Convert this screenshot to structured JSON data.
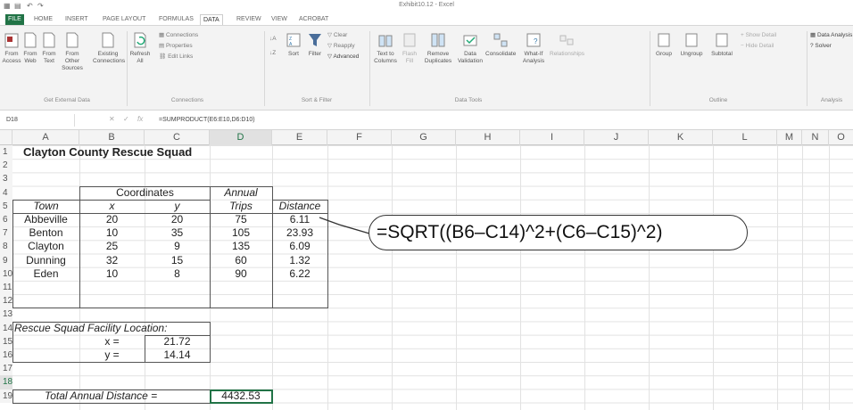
{
  "window": {
    "title": "Exhibit10.12 - Excel"
  },
  "ribbon_tabs": [
    {
      "label": "FILE"
    },
    {
      "label": "HOME"
    },
    {
      "label": "INSERT"
    },
    {
      "label": "PAGE LAYOUT"
    },
    {
      "label": "FORMULAS"
    },
    {
      "label": "DATA"
    },
    {
      "label": "REVIEW"
    },
    {
      "label": "VIEW"
    },
    {
      "label": "ACROBAT"
    }
  ],
  "ribbon": {
    "from_access": "From Access",
    "from_web": "From Web",
    "from_text": "From Text",
    "from_other": "From Other Sources",
    "existing": "Existing Connections",
    "group_external": "Get External Data",
    "refresh": "Refresh All",
    "connections": "Connections",
    "properties": "Properties",
    "edit_links": "Edit Links",
    "group_connections": "Connections",
    "sort": "Sort",
    "filter": "Filter",
    "clear": "Clear",
    "reapply": "Reapply",
    "advanced": "Advanced",
    "group_sort": "Sort & Filter",
    "text_to_columns": "Text to Columns",
    "flash_fill": "Flash Fill",
    "remove_duplicates": "Remove Duplicates",
    "data_validation": "Data Validation",
    "consolidate": "Consolidate",
    "what_if": "What-If Analysis",
    "relationships": "Relationships",
    "group_tools": "Data Tools",
    "group": "Group",
    "ungroup": "Ungroup",
    "subtotal": "Subtotal",
    "show_detail": "Show Detail",
    "hide_detail": "Hide Detail",
    "group_outline": "Outline",
    "data_analysis": "Data Analysis",
    "solver": "Solver",
    "group_analysis": "Analysis"
  },
  "formula_bar": {
    "name_box": "D18",
    "cancel": "✕",
    "enter": "✓",
    "fx": "fx",
    "formula": "=SUMPRODUCT(E6:E10,D6:D10)"
  },
  "columns": [
    "A",
    "B",
    "C",
    "D",
    "E",
    "F",
    "G",
    "H",
    "I",
    "J",
    "K",
    "L",
    "M",
    "N",
    "O"
  ],
  "rows": [
    "1",
    "2",
    "3",
    "4",
    "5",
    "6",
    "7",
    "8",
    "9",
    "10",
    "11",
    "12",
    "13",
    "14",
    "15",
    "16",
    "17",
    "18",
    "19"
  ],
  "sheet": {
    "title": "Clayton County Rescue Squad",
    "coordinates": "Coordinates",
    "annual": "Annual",
    "town": "Town",
    "x": "x",
    "y": "y",
    "trips": "Trips",
    "distance": "Distance",
    "data": [
      {
        "town": "Abbeville",
        "x": "20",
        "y": "20",
        "trips": "75",
        "distance": "6.11"
      },
      {
        "town": "Benton",
        "x": "10",
        "y": "35",
        "trips": "105",
        "distance": "23.93"
      },
      {
        "town": "Clayton",
        "x": "25",
        "y": "9",
        "trips": "135",
        "distance": "6.09"
      },
      {
        "town": "Dunning",
        "x": "32",
        "y": "15",
        "trips": "60",
        "distance": "1.32"
      },
      {
        "town": "Eden",
        "x": "10",
        "y": "8",
        "trips": "90",
        "distance": "6.22"
      }
    ],
    "facility_label": "Rescue Squad Facility Location:",
    "x_eq": "x =",
    "x_val": "21.72",
    "y_eq": "y =",
    "y_val": "14.14",
    "total_label": "Total Annual Distance =",
    "total_val": "4432.53"
  },
  "callout": {
    "text": "=SQRT((B6–C14)^2+(C6–C15)^2)"
  }
}
